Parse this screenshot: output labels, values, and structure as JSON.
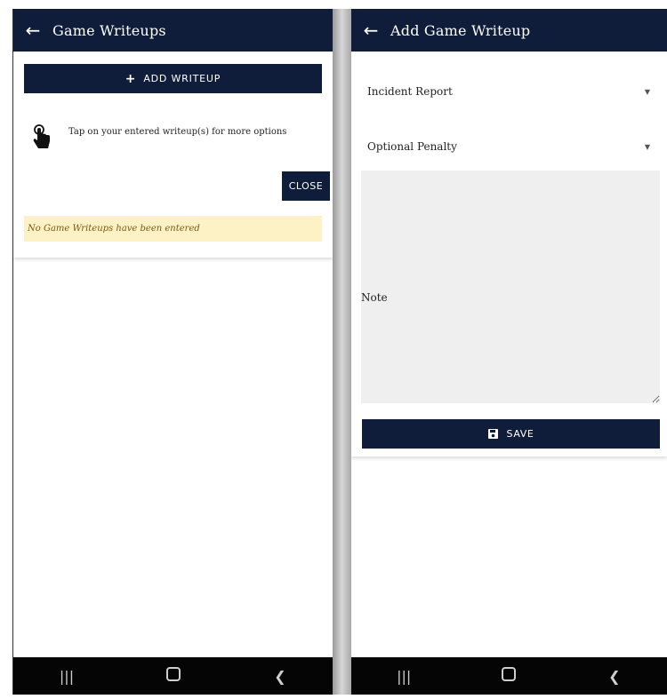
{
  "left": {
    "appbar": {
      "title": "Game Writeups"
    },
    "add_button": {
      "label": "ADD WRITEUP"
    },
    "hint_text": "Tap on your entered writeup(s) for more options",
    "close_button": {
      "label": "CLOSE"
    },
    "empty_message": "No Game Writeups have been entered"
  },
  "right": {
    "appbar": {
      "title": "Add Game Writeup"
    },
    "incident_select": {
      "label": "Incident Report"
    },
    "penalty_select": {
      "label": "Optional Penalty"
    },
    "note": {
      "label": "Note",
      "value": ""
    },
    "save_button": {
      "label": "SAVE"
    }
  },
  "icons": {
    "back": "arrow-left-icon",
    "plus": "plus-icon",
    "tap": "hand-pointer-icon",
    "dropdown": "caret-down-icon",
    "save": "floppy-disk-icon",
    "nav_recents": "recents-icon",
    "nav_home": "home-icon",
    "nav_back": "nav-back-icon"
  },
  "colors": {
    "primary": "#0f1d3a",
    "banner_bg": "#fcf2c5",
    "banner_text": "#7a5a10",
    "navbar": "#050505"
  }
}
